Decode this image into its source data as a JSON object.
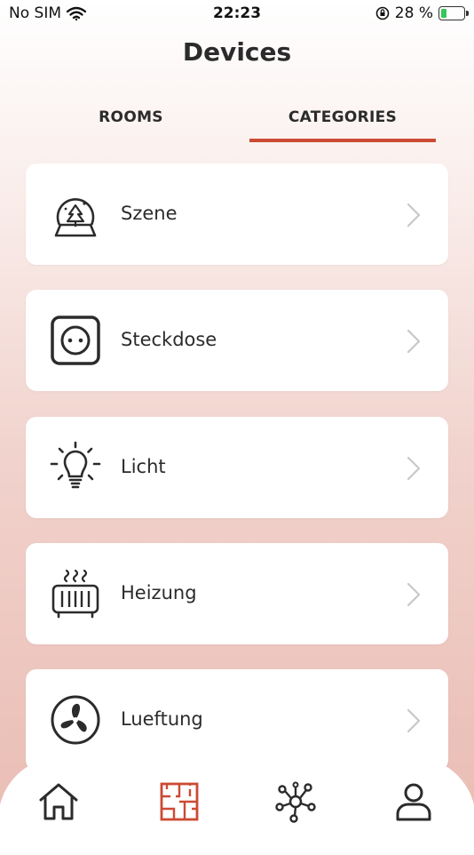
{
  "status": {
    "carrier": "No SIM",
    "time": "22:23",
    "battery_percent": "28 %",
    "battery_level": 0.28
  },
  "header": {
    "title": "Devices"
  },
  "tabs": {
    "rooms": "ROOMS",
    "categories": "CATEGORIES",
    "active": "categories"
  },
  "categories": [
    {
      "label": "Szene",
      "icon": "snow-globe-icon"
    },
    {
      "label": "Steckdose",
      "icon": "power-socket-icon"
    },
    {
      "label": "Licht",
      "icon": "light-bulb-icon"
    },
    {
      "label": "Heizung",
      "icon": "heater-icon"
    },
    {
      "label": "Lueftung",
      "icon": "fan-icon"
    }
  ],
  "bottom_nav": [
    {
      "name": "home",
      "icon": "home-icon"
    },
    {
      "name": "floorplan",
      "icon": "floorplan-icon",
      "active": true
    },
    {
      "name": "network",
      "icon": "network-icon"
    },
    {
      "name": "profile",
      "icon": "user-icon"
    }
  ],
  "colors": {
    "accent": "#cc4a33",
    "text": "#2b2b2b",
    "chevron": "#c8c8c8"
  }
}
